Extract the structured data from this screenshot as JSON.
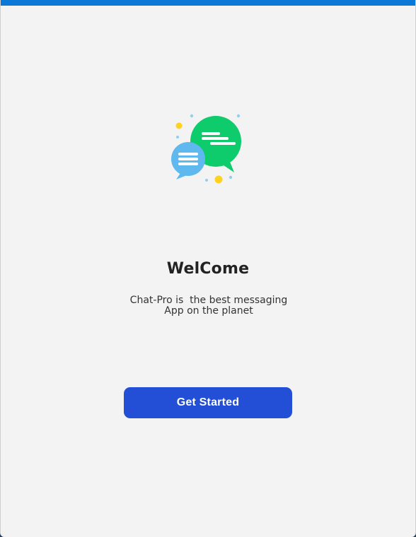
{
  "window": {
    "accent_color": "#0a78d7"
  },
  "logo": {
    "icon": "chat-bubbles-icon",
    "colors": {
      "large_bubble": "#0ecb6b",
      "small_bubble": "#5fb8ee",
      "dots_yellow": "#ffd21f",
      "dots_blue": "#8fd0f2"
    }
  },
  "welcome": {
    "title": "WelCome",
    "subtitle_line1": "Chat-Pro is  the best messaging",
    "subtitle_line2": "App on the planet"
  },
  "cta": {
    "label": "Get Started",
    "color": "#234fd6"
  }
}
